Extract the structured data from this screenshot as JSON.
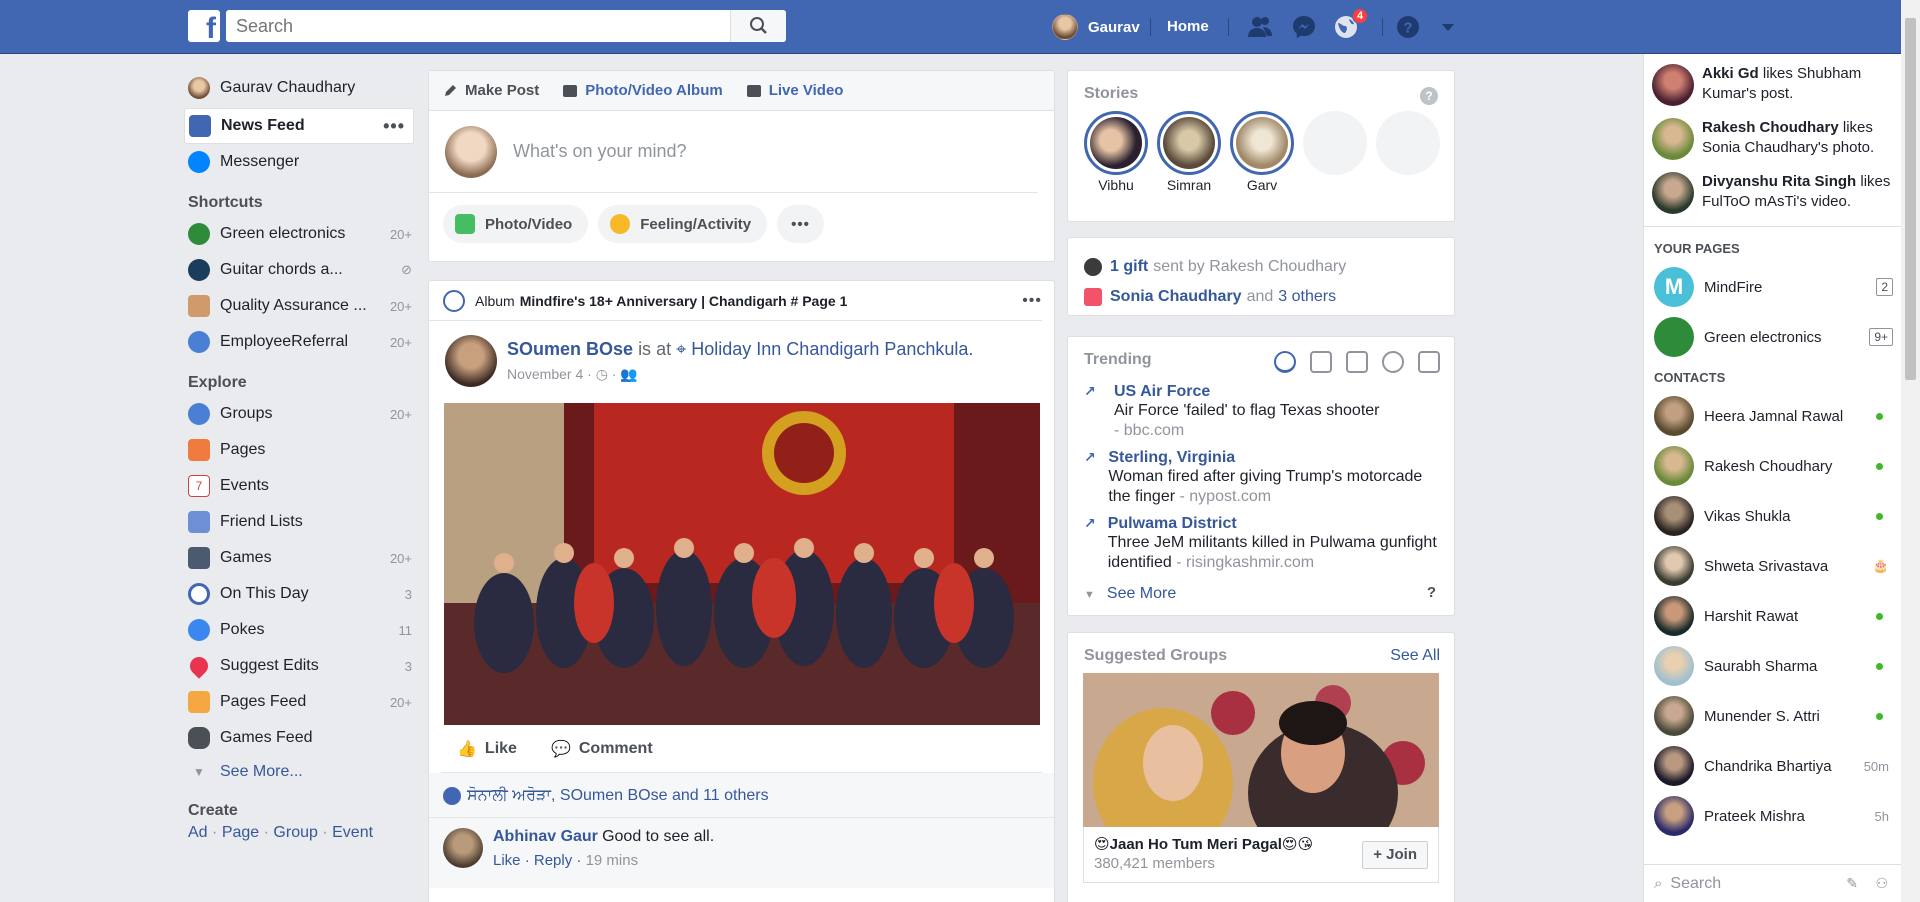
{
  "topbar": {
    "search_placeholder": "Search",
    "user_name": "Gaurav",
    "home_label": "Home",
    "notification_count": "4"
  },
  "leftnav": {
    "profile_name": "Gaurav Chaudhary",
    "news_feed": "News Feed",
    "messenger": "Messenger",
    "shortcuts_heading": "Shortcuts",
    "shortcuts": [
      {
        "label": "Green electronics",
        "count": "20+"
      },
      {
        "label": "Guitar chords a...",
        "count": ""
      },
      {
        "label": "Quality Assurance ...",
        "count": "20+"
      },
      {
        "label": "EmployeeReferral",
        "count": "20+"
      }
    ],
    "explore_heading": "Explore",
    "explore": [
      {
        "label": "Groups",
        "count": "20+"
      },
      {
        "label": "Pages",
        "count": ""
      },
      {
        "label": "Events",
        "count": ""
      },
      {
        "label": "Friend Lists",
        "count": ""
      },
      {
        "label": "Games",
        "count": "20+"
      },
      {
        "label": "On This Day",
        "count": "3"
      },
      {
        "label": "Pokes",
        "count": "11"
      },
      {
        "label": "Suggest Edits",
        "count": "3"
      },
      {
        "label": "Pages Feed",
        "count": "20+"
      },
      {
        "label": "Games Feed",
        "count": ""
      }
    ],
    "see_more": "See More...",
    "create_heading": "Create",
    "create_links": [
      "Ad",
      "Page",
      "Group",
      "Event"
    ]
  },
  "composer": {
    "tab_make_post": "Make Post",
    "tab_album": "Photo/Video Album",
    "tab_live": "Live Video",
    "placeholder": "What's on your mind?",
    "action_photo": "Photo/Video",
    "action_feeling": "Feeling/Activity"
  },
  "post": {
    "album_prefix": "Album",
    "album_title": "Mindfire's 18+ Anniversary | Chandigarh # Page 1",
    "author": "SOumen BOse",
    "is_at": "is at",
    "location": "Holiday Inn Chandigarh Panchkula.",
    "date": "November 4 ·",
    "like": "Like",
    "comment": "Comment",
    "likes_summary": "ਸੋਨਾਲੀ ਅਰੋੜਾ, SOumen BOse and 11 others",
    "comment_author": "Abhinav Gaur",
    "comment_text": "Good to see all.",
    "comment_like": "Like",
    "comment_reply": "Reply",
    "comment_time": "19 mins"
  },
  "stories": {
    "title": "Stories",
    "items": [
      "Vibhu",
      "Simran",
      "Garv"
    ]
  },
  "gifts": {
    "gift_link": "1 gift",
    "gift_text": "sent by Rakesh Choudhary",
    "birthday_name": "Sonia Chaudhary",
    "birthday_and": "and",
    "birthday_others": "3 others"
  },
  "trending": {
    "title": "Trending",
    "items": [
      {
        "topic": "US Air Force",
        "desc": "Air Force 'failed' to flag Texas shooter",
        "src": "- bbc.com"
      },
      {
        "topic": "Sterling, Virginia",
        "desc": "Woman fired after giving Trump's motorcade the finger",
        "src": "- nypost.com"
      },
      {
        "topic": "Pulwama District",
        "desc": "Three JeM militants killed in Pulwama gunfight identified",
        "src": "- risingkashmir.com"
      }
    ],
    "see_more": "See More",
    "help": "?"
  },
  "groups": {
    "title": "Suggested Groups",
    "see_all": "See All",
    "name": "😍Jaan Ho Tum Meri Pagal😍😘",
    "members": "380,421 members",
    "join": "+ Join"
  },
  "chat": {
    "ticker": [
      {
        "name": "Akki Gd",
        "text": "likes Shubham Kumar's post."
      },
      {
        "name": "Rakesh Choudhary",
        "text": "likes Sonia Chaudhary's photo."
      },
      {
        "name": "Divyanshu Rita Singh",
        "text": "likes FulToO mAsTi's video."
      }
    ],
    "your_pages_heading": "YOUR PAGES",
    "pages": [
      {
        "name": "MindFire",
        "count": "2",
        "initial": "M"
      },
      {
        "name": "Green electronics",
        "count": "9+",
        "initial": ""
      }
    ],
    "contacts_heading": "CONTACTS",
    "contacts": [
      {
        "name": "Heera Jamnal Rawal",
        "status": ""
      },
      {
        "name": "Rakesh Choudhary",
        "status": ""
      },
      {
        "name": "Vikas Shukla",
        "status": ""
      },
      {
        "name": "Shweta Srivastava",
        "status": ""
      },
      {
        "name": "Harshit Rawat",
        "status": ""
      },
      {
        "name": "Saurabh Sharma",
        "status": ""
      },
      {
        "name": "Munender S. Attri",
        "status": ""
      },
      {
        "name": "Chandrika Bhartiya",
        "status": "50m"
      },
      {
        "name": "Prateek Mishra",
        "status": "5h"
      }
    ],
    "search_placeholder": "Search"
  },
  "colors": {
    "brand": "#4267b2",
    "link": "#365899",
    "online": "#42b72a",
    "badge": "#fa3e3e"
  }
}
